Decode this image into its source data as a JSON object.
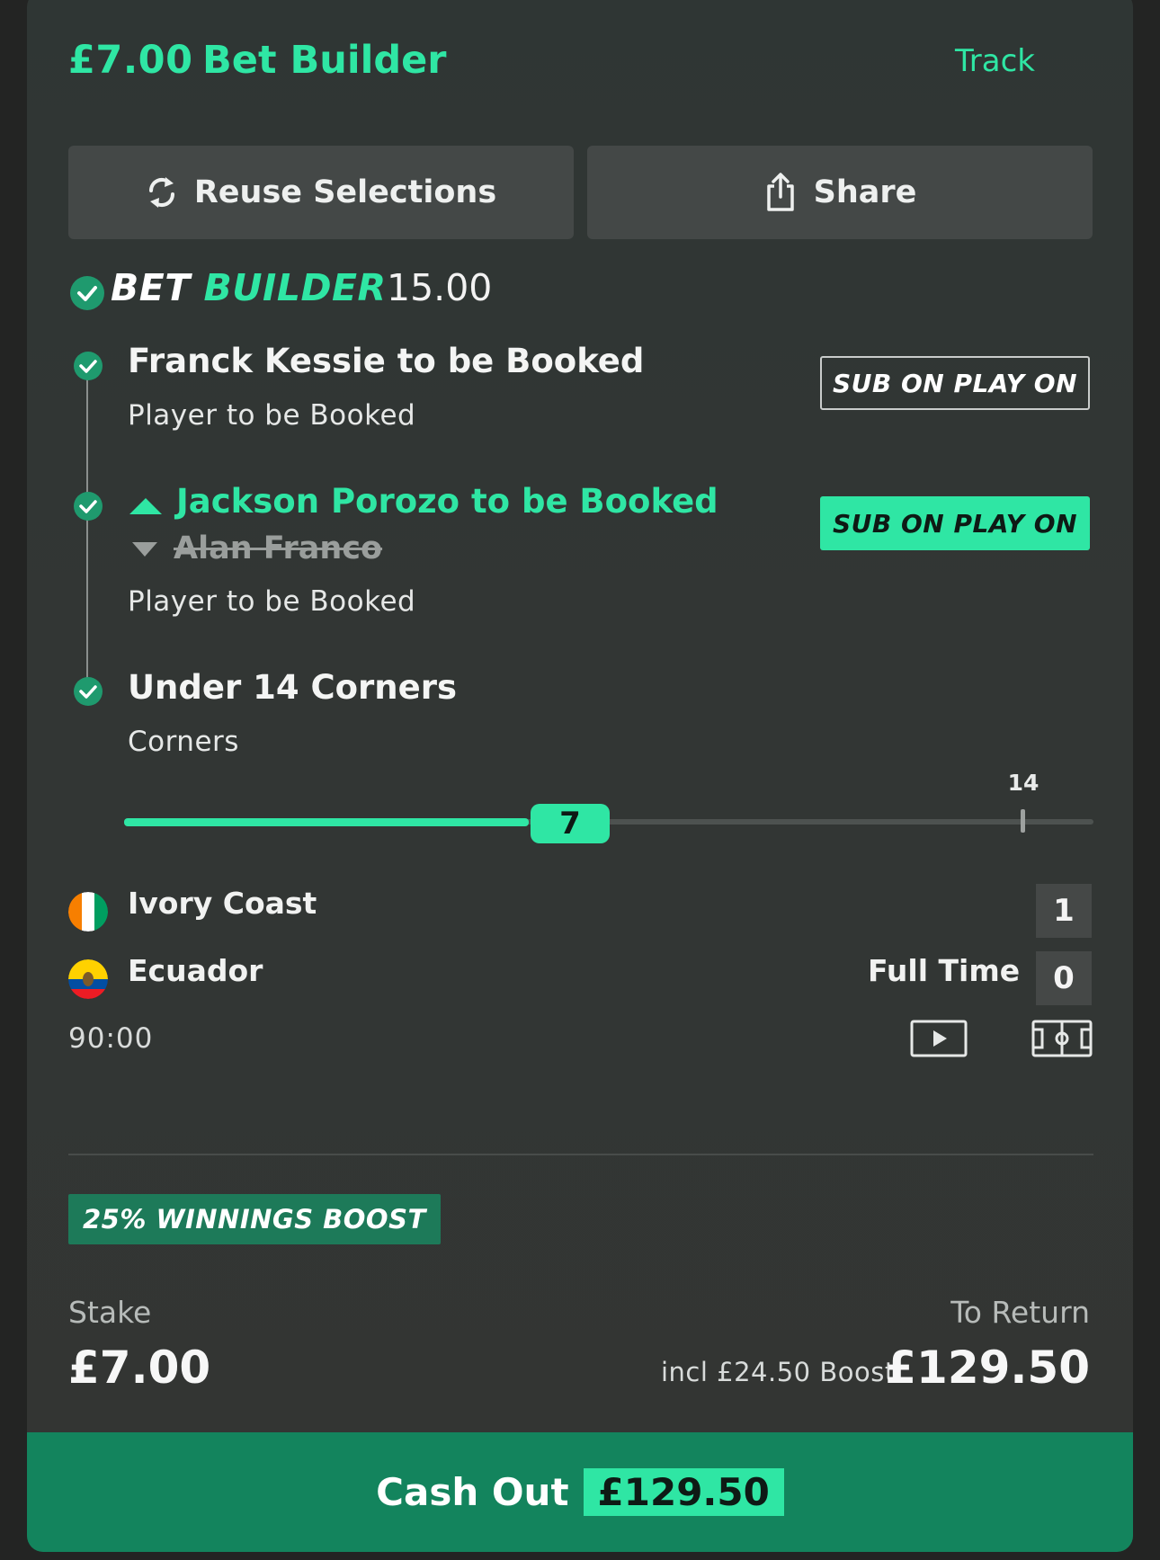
{
  "header": {
    "stake": "£7.00",
    "title": "Bet Builder",
    "track_label": "Track"
  },
  "actions": {
    "reuse_label": "Reuse Selections",
    "share_label": "Share"
  },
  "bet_builder": {
    "logo_part1": "BET",
    "logo_part2": "BUILDER",
    "odds": "15.00"
  },
  "selections": [
    {
      "title": "Franck Kessie to be Booked",
      "market": "Player to be Booked",
      "badge": "SUB ON PLAY ON",
      "badge_active": false
    },
    {
      "title": "Jackson Porozo to be Booked",
      "replaced": "Alan Franco",
      "market": "Player to be Booked",
      "badge": "SUB ON PLAY ON",
      "badge_active": true
    },
    {
      "title": "Under 14 Corners",
      "market": "Corners",
      "slider": {
        "current": "7",
        "max": "14",
        "fraction": 0.5
      }
    }
  ],
  "match": {
    "home": {
      "name": "Ivory Coast",
      "score": "1",
      "flag": "ivory-coast-flag"
    },
    "away": {
      "name": "Ecuador",
      "score": "0",
      "flag": "ecuador-flag"
    },
    "status": "Full Time",
    "clock": "90:00"
  },
  "boost": {
    "label": "25% WINNINGS BOOST"
  },
  "summary": {
    "stake_label": "Stake",
    "stake_value": "£7.00",
    "return_label": "To Return",
    "return_note": "incl £24.50 Boost",
    "return_value": "£129.50"
  },
  "cashout": {
    "label": "Cash Out",
    "amount": "£129.50"
  },
  "colors": {
    "accent": "#2fe6a4",
    "cashout_bg": "#13845d",
    "boost_bg": "#1d7a59",
    "card_bg": "#323634"
  }
}
